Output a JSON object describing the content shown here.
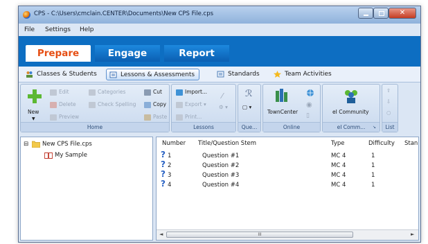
{
  "window": {
    "title": "CPS - C:\\Users\\cmclain.CENTER\\Documents\\New CPS File.cps"
  },
  "menu": [
    "File",
    "Settings",
    "Help"
  ],
  "main_tabs": [
    "Prepare",
    "Engage",
    "Report"
  ],
  "sub_tabs": [
    "Classes & Students",
    "Lessons & Assessments",
    "Standards",
    "Team Activities"
  ],
  "ribbon": {
    "home": {
      "new": "New",
      "edit": "Edit",
      "delete": "Delete",
      "preview": "Preview",
      "categories": "Categories",
      "check_spelling": "Check Spelling",
      "cut": "Cut",
      "copy": "Copy",
      "paste": "Paste",
      "label": "Home"
    },
    "lessons": {
      "import": "Import...",
      "export": "Export",
      "print": "Print...",
      "label": "Lessons"
    },
    "question": {
      "label": "Que..."
    },
    "online": {
      "towncenter": "TownCenter",
      "label": "Online"
    },
    "ei": {
      "community": "eI Community",
      "label": "eI Comm..."
    },
    "list": {
      "label": "List"
    }
  },
  "tree": {
    "root": "New CPS File.cps",
    "child": "My Sample"
  },
  "table": {
    "columns": [
      "Number",
      "Title/Question Stem",
      "Type",
      "Difficulty",
      "Stan"
    ],
    "rows": [
      {
        "number": "1",
        "title": "Question #1",
        "type": "MC 4",
        "difficulty": "1"
      },
      {
        "number": "2",
        "title": "Question #2",
        "type": "MC 4",
        "difficulty": "1"
      },
      {
        "number": "3",
        "title": "Question #3",
        "type": "MC 4",
        "difficulty": "1"
      },
      {
        "number": "4",
        "title": "Question #4",
        "type": "MC 4",
        "difficulty": "1"
      }
    ]
  },
  "scroll": {
    "thumb_grip": "III"
  },
  "colors": {
    "prepare_text": "#e64f14",
    "tabbar_blue": "#0d6ec2",
    "question_icon": "#2a63c4"
  }
}
